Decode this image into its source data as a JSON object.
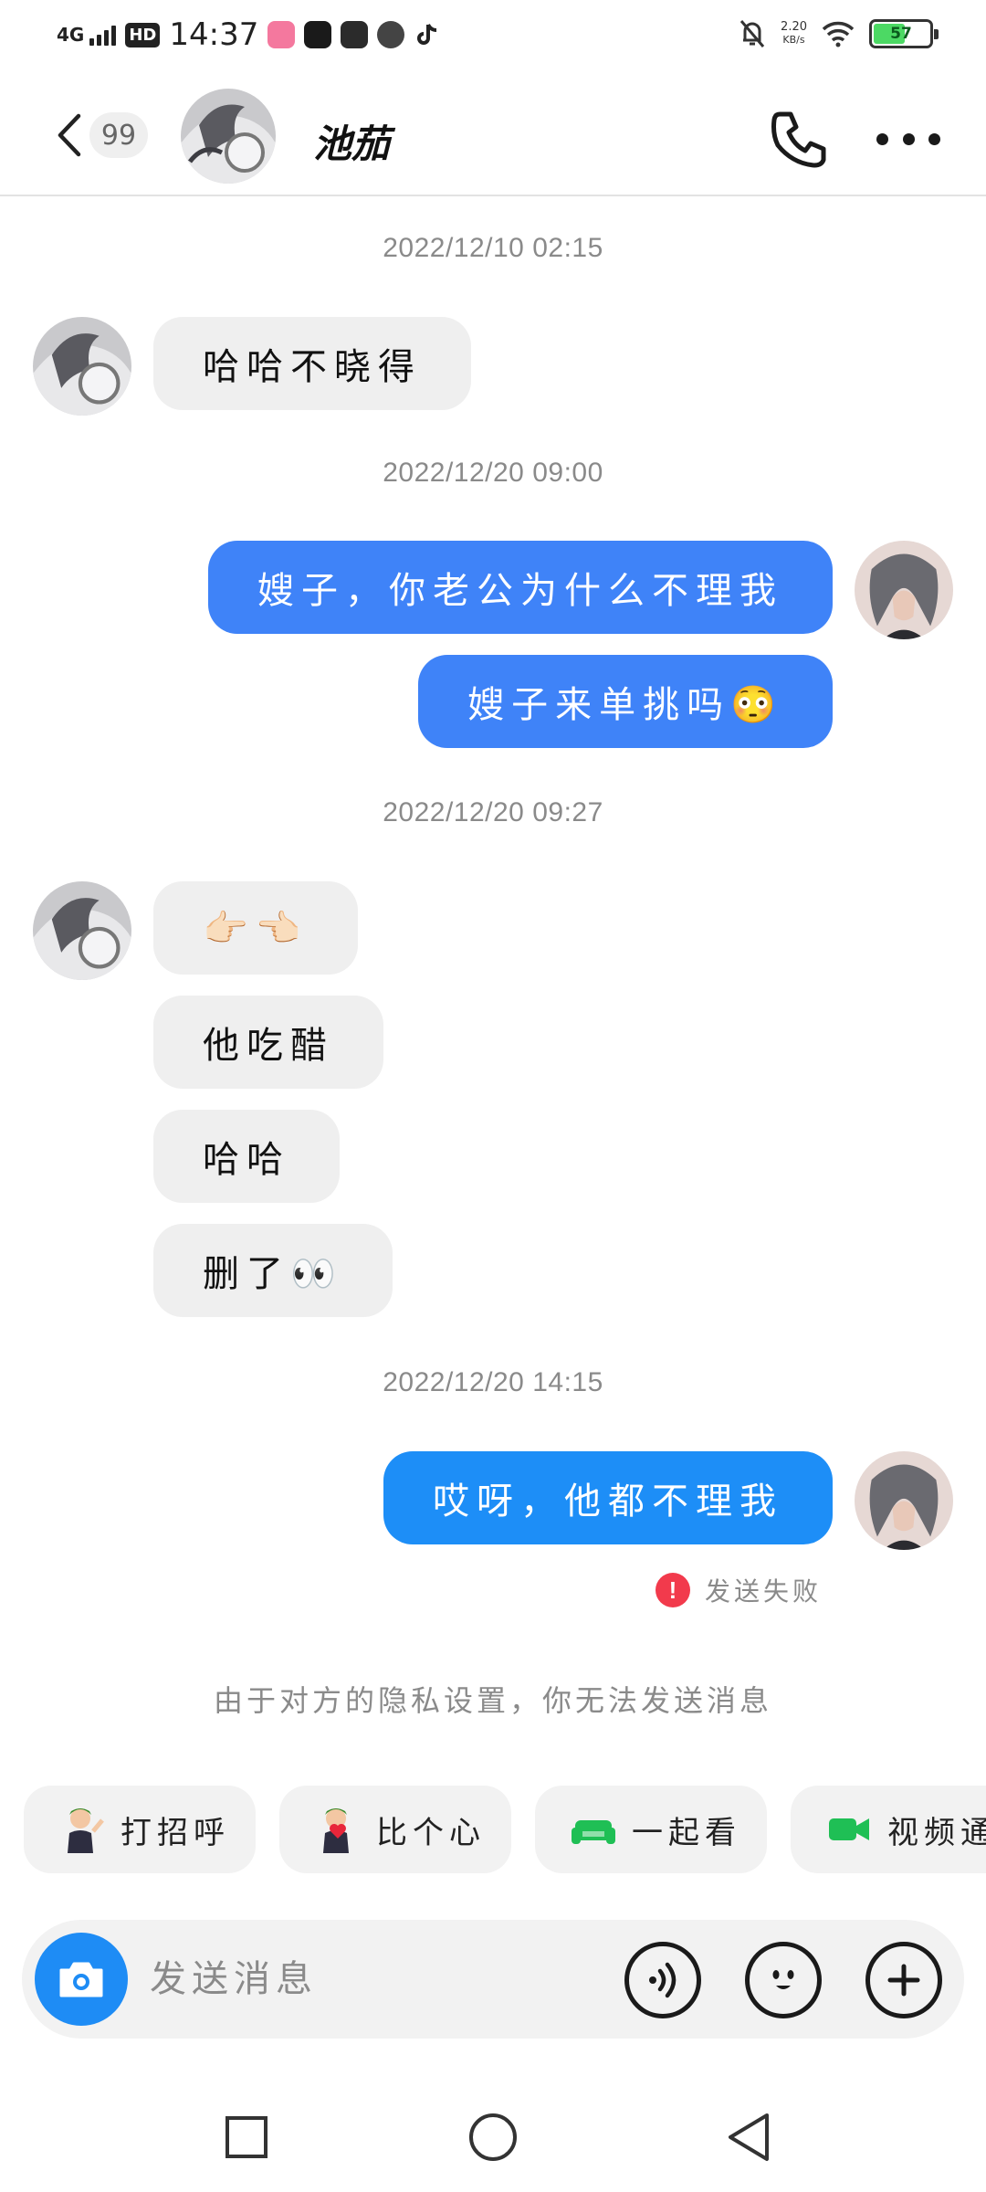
{
  "status_bar": {
    "network": "4G",
    "hd_badge": "HD",
    "time": "14:37",
    "speed_value": "2.20",
    "speed_unit": "KB/s",
    "battery_level": "57",
    "battery_color": "#4cd964"
  },
  "header": {
    "unread_count": "99",
    "contact_name": "池茄",
    "icons": [
      "back-arrow-icon",
      "phone-icon",
      "more-icon"
    ]
  },
  "messages": [
    {
      "type": "timestamp",
      "text": "2022/12/10 02:15"
    },
    {
      "type": "incoming",
      "text": "哈哈不晓得"
    },
    {
      "type": "timestamp",
      "text": "2022/12/20 09:00"
    },
    {
      "type": "outgoing",
      "text": "嫂子，你老公为什么不理我"
    },
    {
      "type": "outgoing",
      "text": "嫂子来单挑吗😳"
    },
    {
      "type": "timestamp",
      "text": "2022/12/20 09:27"
    },
    {
      "type": "incoming",
      "text": "👉🏻👈🏻"
    },
    {
      "type": "incoming",
      "text": "他吃醋"
    },
    {
      "type": "incoming",
      "text": "哈哈"
    },
    {
      "type": "incoming",
      "text": "删了👀"
    },
    {
      "type": "timestamp",
      "text": "2022/12/20 14:15"
    },
    {
      "type": "outgoing",
      "text": "哎呀，他都不理我"
    }
  ],
  "failed_status": {
    "icon": "!",
    "text": "发送失败"
  },
  "privacy_notice": "由于对方的隐私设置，你无法发送消息",
  "quick_actions": [
    {
      "label": "打招呼",
      "icon": "wave-avatar-icon"
    },
    {
      "label": "比个心",
      "icon": "heart-avatar-icon"
    },
    {
      "label": "一起看",
      "icon": "sofa-icon"
    },
    {
      "label": "视频通",
      "icon": "video-camera-icon"
    }
  ],
  "composer": {
    "placeholder": "发送消息",
    "icons": [
      "camera-icon",
      "voice-icon",
      "emoji-icon",
      "plus-icon"
    ],
    "accent_color": "#1e8cf5"
  },
  "colors": {
    "outgoing_bubble": "#3f83f8",
    "outgoing_bubble_bright": "#1d8ef7",
    "incoming_bubble": "#efefef",
    "failed": "#f23a4c"
  }
}
